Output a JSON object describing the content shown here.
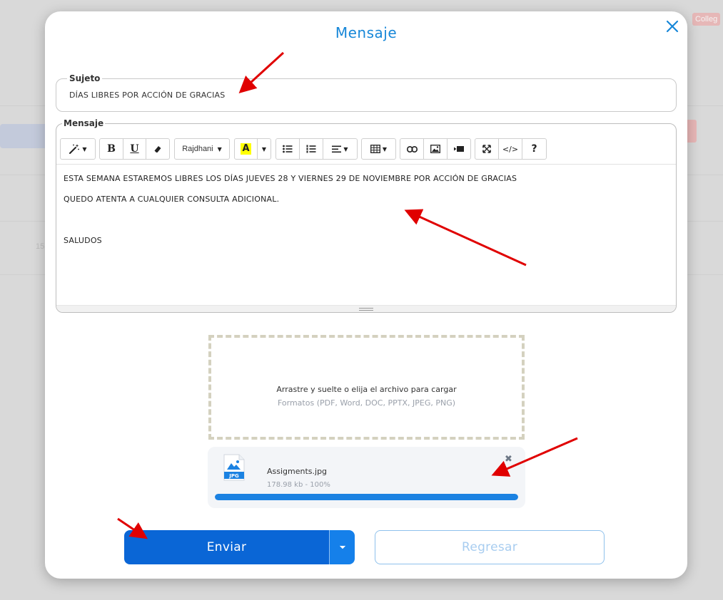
{
  "background": {
    "badge": "Colleg",
    "number": "15"
  },
  "modal": {
    "title": "Mensaje",
    "close_icon": "close-icon"
  },
  "subject": {
    "label": "Sujeto",
    "value": "DÍAS LIBRES POR ACCIÓN DE GRACIAS"
  },
  "editor": {
    "label": "Mensaje",
    "toolbar": {
      "style_icon": "magic-wand-icon",
      "bold": "B",
      "underline": "U",
      "eraser_icon": "eraser-icon",
      "font_name": "Rajdhani",
      "highlight": "A",
      "highlight_color": "#ffff00",
      "unordered_list_icon": "unordered-list-icon",
      "ordered_list_icon": "ordered-list-icon",
      "align_icon": "align-left-icon",
      "table_icon": "table-icon",
      "link_icon": "link-icon",
      "image_icon": "image-icon",
      "video_icon": "video-icon",
      "fullscreen_icon": "fullscreen-icon",
      "code": "</>",
      "help": "?"
    },
    "lines": [
      "ESTA SEMANA ESTAREMOS LIBRES LOS DÍAS JUEVES 28 Y VIERNES 29 DE NOVIEMBRE POR ACCIÓN DE GRACIAS",
      "QUEDO ATENTA A CUALQUIER CONSULTA ADICIONAL.",
      "",
      "SALUDOS"
    ]
  },
  "dropzone": {
    "text": "Arrastre y suelte o elija el archivo para cargar",
    "formats": "Formatos (PDF, Word, DOC, PPTX, JPEG, PNG)"
  },
  "file": {
    "name": "Assigments.jpg",
    "meta": "178.98 kb - 100%",
    "type_label": "JPG",
    "progress": 1.0,
    "remove": "✖"
  },
  "buttons": {
    "send": "Enviar",
    "back": "Regresar"
  },
  "colors": {
    "accent": "#1787d8",
    "primary": "#0a66d6",
    "annotation": "#e00000"
  }
}
